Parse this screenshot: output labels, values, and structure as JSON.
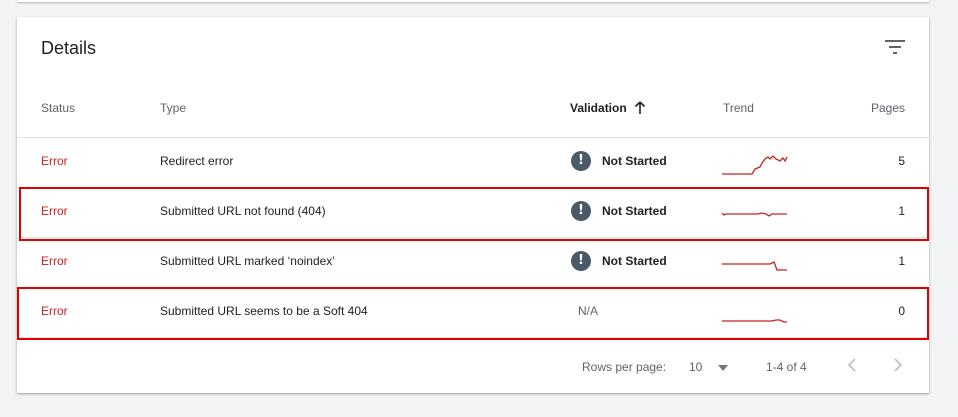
{
  "details": {
    "title": "Details",
    "columns": {
      "status": "Status",
      "type": "Type",
      "validation": "Validation",
      "trend": "Trend",
      "pages": "Pages"
    },
    "rows": [
      {
        "status": "Error",
        "type": "Redirect error",
        "validation": "Not Started",
        "validation_icon": "exclamation-icon",
        "pages": "5"
      },
      {
        "status": "Error",
        "type": "Submitted URL not found (404)",
        "validation": "Not Started",
        "validation_icon": "exclamation-icon",
        "pages": "1"
      },
      {
        "status": "Error",
        "type": "Submitted URL marked ‘noindex’",
        "validation": "Not Started",
        "validation_icon": "exclamation-icon",
        "pages": "1"
      },
      {
        "status": "Error",
        "type": "Submitted URL seems to be a Soft 404",
        "validation": "N/A",
        "pages": "0"
      }
    ],
    "footer": {
      "rows_per_page_label": "Rows per page:",
      "rows_per_page_value": "10",
      "range": "1-4 of 4"
    }
  },
  "colors": {
    "error": "#c5221f",
    "trend_line": "#c5221f",
    "highlight": "#e00000",
    "validation_icon_bg": "#4a5a66"
  }
}
